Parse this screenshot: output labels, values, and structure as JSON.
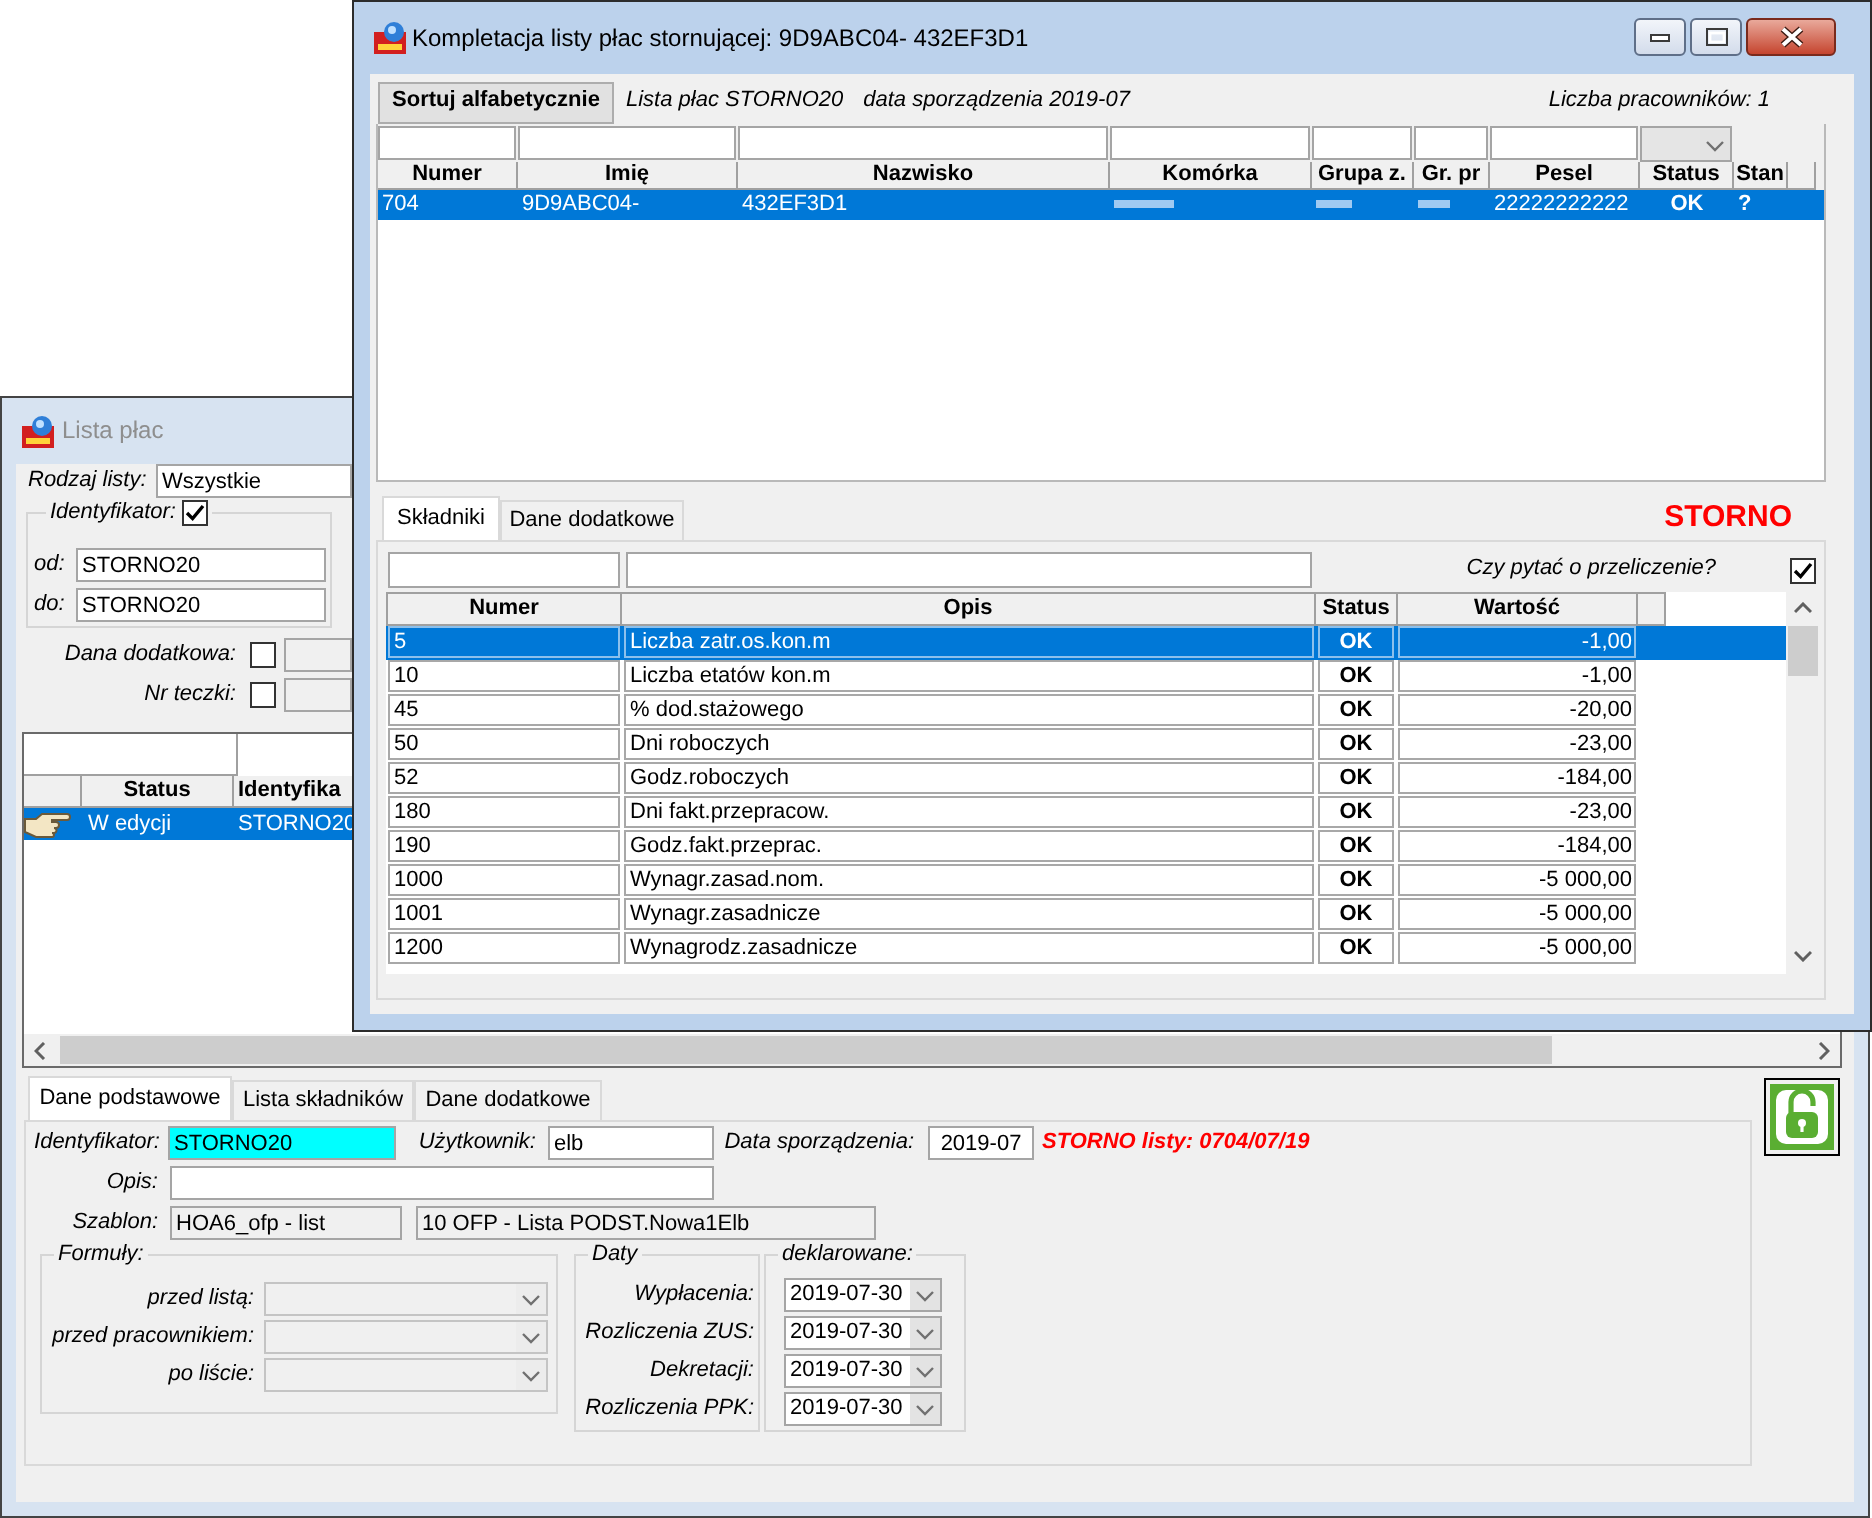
{
  "list_window": {
    "title": "Lista płac",
    "active": false,
    "list_type": {
      "label": "Rodzaj listy:",
      "value": "Wszystkie"
    },
    "id_filter": {
      "label": "Identyfikator:",
      "checked": true,
      "rows": [
        {
          "label": "od:",
          "value": "STORNO20"
        },
        {
          "label": "do:",
          "value": "STORNO20"
        }
      ]
    },
    "extra_filters": [
      {
        "label": "Dana dodatkowa:",
        "checked": false
      },
      {
        "label": "Nr teczki:",
        "checked": false
      }
    ],
    "grid": {
      "columns": [
        "Status",
        "Identyfika"
      ],
      "rows": [
        {
          "selected": true,
          "cells": [
            "W edycji",
            "STORNO20"
          ]
        }
      ]
    },
    "tabs": [
      {
        "label": "Dane podstawowe",
        "selected": true
      },
      {
        "label": "Lista składników",
        "selected": false
      },
      {
        "label": "Dane dodatkowe",
        "selected": false
      }
    ],
    "header_fields": [
      {
        "label": "Identyfikator:",
        "value": "STORNO20",
        "highlighted": true
      },
      {
        "label": "Użytkownik:",
        "value": "elb",
        "highlighted": false
      },
      {
        "label": "Data sporządzenia:",
        "value": "2019-07",
        "highlighted": false
      }
    ],
    "storno_note": "STORNO listy: 0704/07/19",
    "description": {
      "label": "Opis:"
    },
    "template": {
      "label": "Szablon:",
      "values": [
        "HOA6_ofp - list",
        "10 OFP - Lista PODST.Nowa1Elb"
      ]
    },
    "formulas": {
      "title": "Formuły:",
      "items": [
        {
          "label": "przed listą:",
          "disabled": true
        },
        {
          "label": "przed pracownikiem:",
          "disabled": true
        },
        {
          "label": "po liście:",
          "disabled": true
        }
      ]
    },
    "dates": {
      "title": "Daty",
      "declared_title": "deklarowane:",
      "items": [
        {
          "label": "Wypłacenia:",
          "value": "2019-07-30"
        },
        {
          "label": "Rozliczenia ZUS:",
          "value": "2019-07-30"
        },
        {
          "label": "Dekretacji:",
          "value": "2019-07-30"
        },
        {
          "label": "Rozliczenia PPK:",
          "value": "2019-07-30"
        }
      ]
    },
    "lock": {
      "locked": false
    }
  },
  "storno_window": {
    "title": "Kompletacja listy płac stornującej: 9D9ABC04- 432EF3D1",
    "active": true,
    "sort_button": "Sortuj alfabetycznie",
    "info": [
      "Lista płac STORNO20",
      "data sporządzenia 2019-07"
    ],
    "employee_count": "Liczba pracowników: 1",
    "employees": {
      "columns": [
        "Numer",
        "Imię",
        "Nazwisko",
        "Komórka",
        "Grupa z.",
        "Gr. pr",
        "Pesel",
        "Status",
        "Stan"
      ],
      "rows": [
        {
          "selected": true,
          "cells": [
            {
              "kind": "text",
              "text": "704"
            },
            {
              "kind": "text",
              "text": "9D9ABC04-"
            },
            {
              "kind": "text",
              "text": "432EF3D1"
            },
            {
              "kind": "redacted"
            },
            {
              "kind": "redacted"
            },
            {
              "kind": "redacted"
            },
            {
              "kind": "text",
              "text": "22222222222"
            },
            {
              "kind": "text",
              "text": "OK"
            },
            {
              "kind": "text",
              "text": "?"
            }
          ]
        }
      ]
    },
    "tabs": [
      {
        "label": "Składniki",
        "selected": true
      },
      {
        "label": "Dane dodatkowe",
        "selected": false
      }
    ],
    "storno_label": "STORNO",
    "recalc": {
      "label": "Czy pytać o przeliczenie?",
      "checked": true
    },
    "components": {
      "columns": [
        "Numer",
        "Opis",
        "Status",
        "Wartość"
      ],
      "rows": [
        {
          "number": "5",
          "description": "Liczba zatr.os.kon.m",
          "status": "OK",
          "value": "-1,00",
          "selected": true
        },
        {
          "number": "10",
          "description": "Liczba etatów kon.m",
          "status": "OK",
          "value": "-1,00",
          "selected": false
        },
        {
          "number": "45",
          "description": "% dod.stażowego",
          "status": "OK",
          "value": "-20,00",
          "selected": false
        },
        {
          "number": "50",
          "description": "Dni roboczych",
          "status": "OK",
          "value": "-23,00",
          "selected": false
        },
        {
          "number": "52",
          "description": "Godz.roboczych",
          "status": "OK",
          "value": "-184,00",
          "selected": false
        },
        {
          "number": "180",
          "description": "Dni fakt.przepracow.",
          "status": "OK",
          "value": "-23,00",
          "selected": false
        },
        {
          "number": "190",
          "description": "Godz.fakt.przeprac.",
          "status": "OK",
          "value": "-184,00",
          "selected": false
        },
        {
          "number": "1000",
          "description": "Wynagr.zasad.nom.",
          "status": "OK",
          "value": "-5 000,00",
          "selected": false
        },
        {
          "number": "1001",
          "description": "Wynagr.zasadnicze",
          "status": "OK",
          "value": "-5 000,00",
          "selected": false
        },
        {
          "number": "1200",
          "description": "Wynagrodz.zasadnicze",
          "status": "OK",
          "value": "-5 000,00",
          "selected": false
        }
      ]
    }
  }
}
